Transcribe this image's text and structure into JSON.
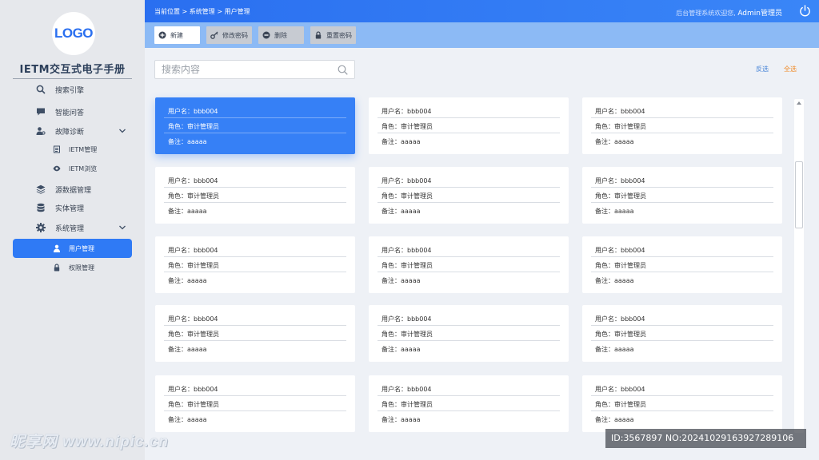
{
  "sidebar": {
    "logo": "LOGO",
    "title": "IETM交互式电子手册",
    "items": [
      {
        "label": "搜索引擎",
        "icon": "search-icon"
      },
      {
        "label": "智能问答",
        "icon": "chat-icon"
      },
      {
        "label": "故障诊断",
        "icon": "diagnosis-icon"
      },
      {
        "label": "IETM管理",
        "icon": "document-icon"
      },
      {
        "label": "IETM浏览",
        "icon": "eye-icon"
      },
      {
        "label": "源数据管理",
        "icon": "layers-icon"
      },
      {
        "label": "实体管理",
        "icon": "database-icon"
      },
      {
        "label": "系统管理",
        "icon": "gear-icon"
      },
      {
        "label": "用户管理",
        "icon": "user-icon"
      },
      {
        "label": "权限管理",
        "icon": "lock-icon"
      }
    ]
  },
  "header": {
    "breadcrumb": "当前位置 > 系统管理 > 用户管理",
    "welcome": "后台管理系统欢迎您,",
    "user": "Admin管理员"
  },
  "toolbar": {
    "new": "新建",
    "change_password": "修改密码",
    "delete": "删除",
    "reset_password": "重置密码"
  },
  "search": {
    "placeholder": "搜索内容"
  },
  "actions": {
    "invert": "反选",
    "select_all": "全选"
  },
  "cards": [
    {
      "username": "用户名：bbb004",
      "role": "角色：审计管理员",
      "note": "备注：aaaaa",
      "selected": true
    },
    {
      "username": "用户名：bbb004",
      "role": "角色：审计管理员",
      "note": "备注：aaaaa"
    },
    {
      "username": "用户名：bbb004",
      "role": "角色：审计管理员",
      "note": "备注：aaaaa"
    },
    {
      "username": "用户名：bbb004",
      "role": "角色：审计管理员",
      "note": "备注：aaaaa"
    },
    {
      "username": "用户名：bbb004",
      "role": "角色：审计管理员",
      "note": "备注：aaaaa"
    },
    {
      "username": "用户名：bbb004",
      "role": "角色：审计管理员",
      "note": "备注：aaaaa"
    },
    {
      "username": "用户名：bbb004",
      "role": "角色：审计管理员",
      "note": "备注：aaaaa"
    },
    {
      "username": "用户名：bbb004",
      "role": "角色：审计管理员",
      "note": "备注：aaaaa"
    },
    {
      "username": "用户名：bbb004",
      "role": "角色：审计管理员",
      "note": "备注：aaaaa"
    },
    {
      "username": "用户名：bbb004",
      "role": "角色：审计管理员",
      "note": "备注：aaaaa"
    },
    {
      "username": "用户名：bbb004",
      "role": "角色：审计管理员",
      "note": "备注：aaaaa"
    },
    {
      "username": "用户名：bbb004",
      "role": "角色：审计管理员",
      "note": "备注：aaaaa"
    },
    {
      "username": "用户名：bbb004",
      "role": "角色：审计管理员",
      "note": "备注：aaaaa"
    },
    {
      "username": "用户名：bbb004",
      "role": "角色：审计管理员",
      "note": "备注：aaaaa"
    },
    {
      "username": "用户名：bbb004",
      "role": "角色：审计管理员",
      "note": "备注：aaaaa"
    }
  ],
  "watermark": {
    "left": "昵享网 www.nipic.cn",
    "right": "ID:3567897 NO:20241029163927289106"
  },
  "colors": {
    "accent": "#2f7af5",
    "header": "#2a6ff0",
    "toolbar": "#8cbaf5",
    "select_all": "#f08c2a"
  }
}
